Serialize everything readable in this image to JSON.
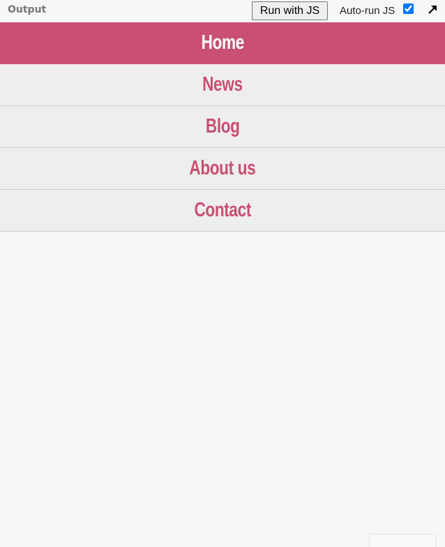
{
  "toolbar": {
    "output_label": "Output",
    "run_button_label": "Run with JS",
    "autorun_label": "Auto-run JS",
    "autorun_checked": true,
    "popout_icon": "arrow-up-right-icon"
  },
  "nav": {
    "items": [
      {
        "label": "Home",
        "active": true
      },
      {
        "label": "News",
        "active": false
      },
      {
        "label": "Blog",
        "active": false
      },
      {
        "label": "About us",
        "active": false
      },
      {
        "label": "Contact",
        "active": false
      }
    ]
  },
  "colors": {
    "accent": "#c95073",
    "nav_background": "#eeeeee",
    "page_background": "#f7f7f7"
  }
}
